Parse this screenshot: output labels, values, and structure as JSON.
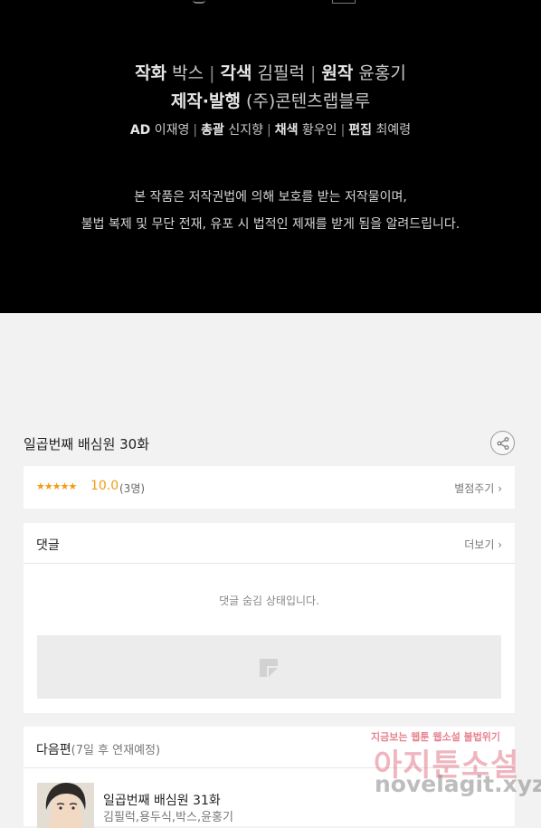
{
  "credits": {
    "line1": [
      {
        "role": "작화",
        "name": "박스"
      },
      {
        "role": "각색",
        "name": "김필럭"
      },
      {
        "role": "원작",
        "name": "윤홍기"
      }
    ],
    "line2": {
      "role": "제작·발행",
      "name": "(주)콘텐츠랩블루"
    },
    "line3": [
      {
        "role": "AD",
        "name": "이재영"
      },
      {
        "role": "총괄",
        "name": "신지향"
      },
      {
        "role": "채색",
        "name": "황우인"
      },
      {
        "role": "편집",
        "name": "최예령"
      }
    ],
    "separator": "|",
    "copyright_line1": "본 작품은 저작권법에 의해 보호를 받는 저작물이며,",
    "copyright_line2": "불법 복제 및 무단 전재, 유포 시 법적인 제재를 받게 됨을 알려드립니다."
  },
  "episode": {
    "title": "일곱번째 배심원 30화",
    "share_icon": "share-icon"
  },
  "rating": {
    "stars": "★★★★★",
    "score": "10.0",
    "count": "(3명)",
    "rate_label": "별점주기",
    "chevron": "›",
    "star_color": "#f39c12"
  },
  "comments": {
    "title": "댓글",
    "more_label": "더보기",
    "chevron": "›",
    "hidden_notice": "댓글 숨김 상태입니다."
  },
  "next_episode": {
    "title": "다음편",
    "schedule": "(7일 후 연재예정)",
    "ep_title": "일곱번째 배심원 31화",
    "authors": "김필럭,용두식,박스,윤홍기"
  },
  "watermark": {
    "tagline": "지금보는 웹툰 웹소설 불법위기",
    "name": "아지툰소설",
    "url": "novelagit.xyz"
  }
}
